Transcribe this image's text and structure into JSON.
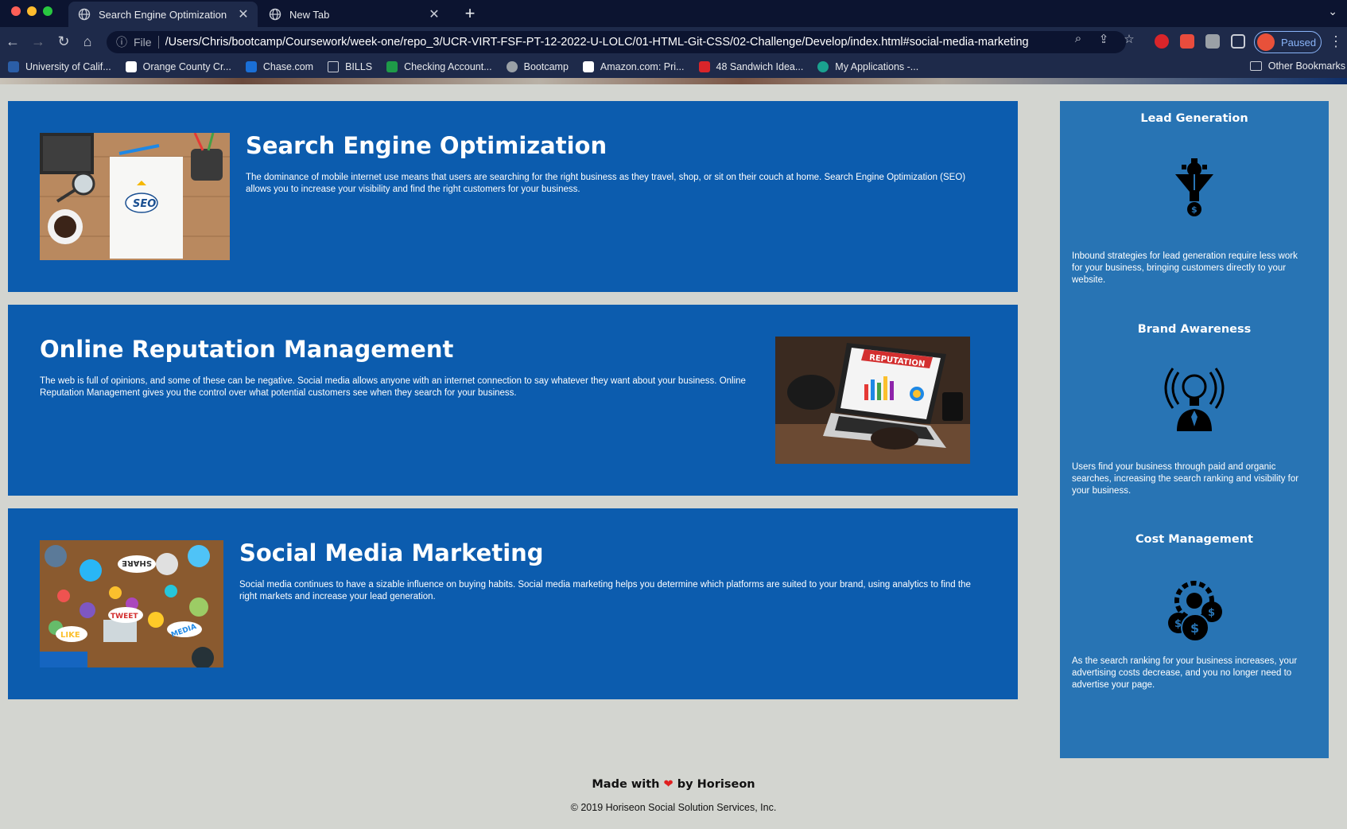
{
  "browser": {
    "tabs": [
      {
        "title": "Search Engine Optimization",
        "active": true
      },
      {
        "title": "New Tab",
        "active": false
      }
    ],
    "address": {
      "scheme": "File",
      "url": "/Users/Chris/bootcamp/Coursework/week-one/repo_3/UCR-VIRT-FSF-PT-12-2022-U-LOLC/01-HTML-Git-CSS/02-Challenge/Develop/index.html#social-media-marketing"
    },
    "profile_status": "Paused",
    "bookmarks": [
      {
        "label": "University of Calif...",
        "icon_color": "#2b5ea7"
      },
      {
        "label": "Orange County Cr...",
        "icon_color": "#ffffff"
      },
      {
        "label": "Chase.com",
        "icon_color": "#1a6fd6"
      },
      {
        "label": "BILLS",
        "icon_color": "folder"
      },
      {
        "label": "Checking Account...",
        "icon_color": "#1e9b48"
      },
      {
        "label": "Bootcamp",
        "icon_color": "#9aa0a6"
      },
      {
        "label": "Amazon.com: Pri...",
        "icon_color": "#ffffff"
      },
      {
        "label": "48 Sandwich Idea...",
        "icon_color": "#d9252a"
      },
      {
        "label": "My Applications -...",
        "icon_color": "#1aa28f"
      }
    ],
    "other_bookmarks": "Other Bookmarks"
  },
  "content": [
    {
      "id": "search-engine-optimization",
      "title": "Search Engine Optimization",
      "text": "The dominance of mobile internet use means that users are searching for the right business as they travel, shop, or sit on their couch at home. Search Engine Optimization (SEO) allows you to increase your visibility and find the right customers for your business."
    },
    {
      "id": "online-reputation-management",
      "title": "Online Reputation Management",
      "text": "The web is full of opinions, and some of these can be negative. Social media allows anyone with an internet connection to say whatever they want about your business. Online Reputation Management gives you the control over what potential customers see when they search for your business."
    },
    {
      "id": "social-media-marketing",
      "title": "Social Media Marketing",
      "text": "Social media continues to have a sizable influence on buying habits. Social media marketing helps you determine which platforms are suited to your brand, using analytics to find the right markets and increase your lead generation."
    }
  ],
  "image_labels": {
    "seo": "SEO",
    "reputation": "REPUTATION",
    "share": "SHARE",
    "tweet": "TWEET",
    "like": "LIKE",
    "media": "MEDIA"
  },
  "benefits": [
    {
      "title": "Lead Generation",
      "icon": "lead-generation-icon",
      "text": "Inbound strategies for lead generation require less work for your business, bringing customers directly to your website."
    },
    {
      "title": "Brand Awareness",
      "icon": "brand-awareness-icon",
      "text": "Users find your business through paid and organic searches, increasing the search ranking and visibility for your business."
    },
    {
      "title": "Cost Management",
      "icon": "cost-management-icon",
      "text": "As the search ranking for your business increases, your advertising costs decrease, and you no longer need to advertise your page."
    }
  ],
  "footer": {
    "made_with": "Made with",
    "by": "by Horiseon",
    "copyright": "© 2019 Horiseon Social Solution Services, Inc."
  },
  "colors": {
    "content_bg": "#0c5cae",
    "benefits_bg": "#2874b4",
    "page_bg": "#d3d5d0",
    "chrome_bg": "#1e2a4a"
  }
}
